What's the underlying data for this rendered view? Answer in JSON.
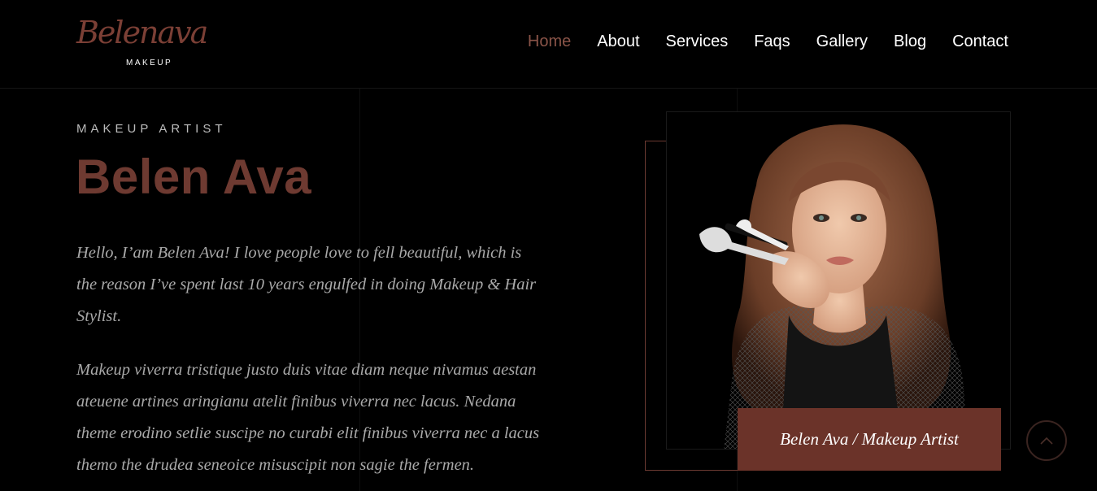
{
  "logo": {
    "script": "Belenava",
    "sub": "MAKEUP"
  },
  "nav": [
    {
      "label": "Home",
      "active": true
    },
    {
      "label": "About"
    },
    {
      "label": "Services"
    },
    {
      "label": "Faqs"
    },
    {
      "label": "Gallery"
    },
    {
      "label": "Blog"
    },
    {
      "label": "Contact"
    }
  ],
  "hero": {
    "eyebrow": "MAKEUP ARTIST",
    "title": "Belen Ava",
    "paragraph1": "Hello, I’am Belen Ava! I love people love to fell beautiful, which is the reason I’ve spent last 10 years engulfed in doing Makeup & Hair Stylist.",
    "paragraph2": "Makeup viverra tristique justo duis vitae diam neque nivamus aestan ateuene artines aringianu atelit finibus viverra nec lacus. Nedana theme erodino setlie suscipe no curabi elit finibus viverra nec a lacus themo the drudea seneoice misuscipit non sagie the fermen.",
    "caption": "Belen Ava / Makeup Artist"
  },
  "icons": {
    "scroll_top": "chevron-up-icon"
  },
  "colors": {
    "accent": "#6b3329",
    "accent_text": "#6e3a31",
    "nav_active": "#8a5448"
  }
}
